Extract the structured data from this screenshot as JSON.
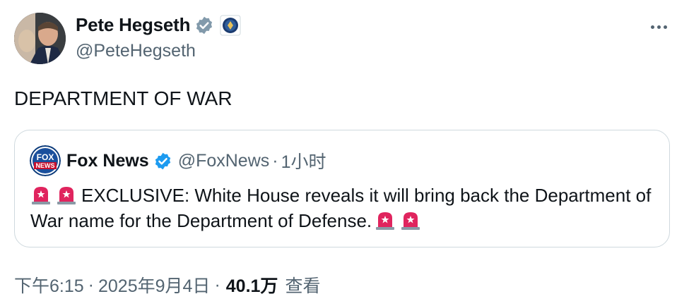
{
  "author": {
    "display_name": "Pete Hegseth",
    "handle": "@PeteHegseth",
    "verified_icon": "verified-badge-icon",
    "affiliation_icon": "department-seal-icon"
  },
  "tweet": {
    "text": "DEPARTMENT OF WAR"
  },
  "quoted": {
    "display_name": "Fox News",
    "handle": "@FoxNews",
    "separator": "·",
    "time": "1小时",
    "avatar_logo_top": "FOX",
    "avatar_logo_bottom": "NEWS",
    "text_main": "EXCLUSIVE: White House reveals it will bring back the Department of War name for the Department of Defense."
  },
  "meta": {
    "time": "下午6:15",
    "sep1": "·",
    "date": "2025年9月4日",
    "sep2": "·",
    "views_count": "40.1万",
    "views_label": "查看"
  },
  "colors": {
    "verified_blue": "#1d9bf0",
    "secondary_text": "#536471",
    "border": "#cfd9de",
    "siren_red": "#e0245e"
  }
}
